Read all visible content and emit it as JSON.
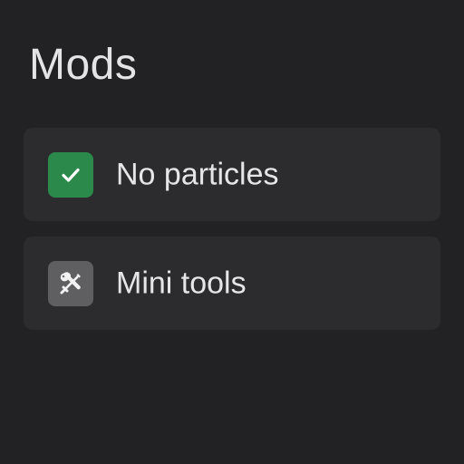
{
  "header": {
    "title": "Mods"
  },
  "mods": [
    {
      "label": "No particles",
      "icon": "checkmark-icon",
      "checked": true,
      "icon_bg": "#2b8a4b"
    },
    {
      "label": "Mini tools",
      "icon": "tools-icon",
      "icon_bg": "#5f5f62"
    }
  ],
  "colors": {
    "background": "#222225",
    "card": "#2c2c2f",
    "text": "#e6e6e8"
  }
}
